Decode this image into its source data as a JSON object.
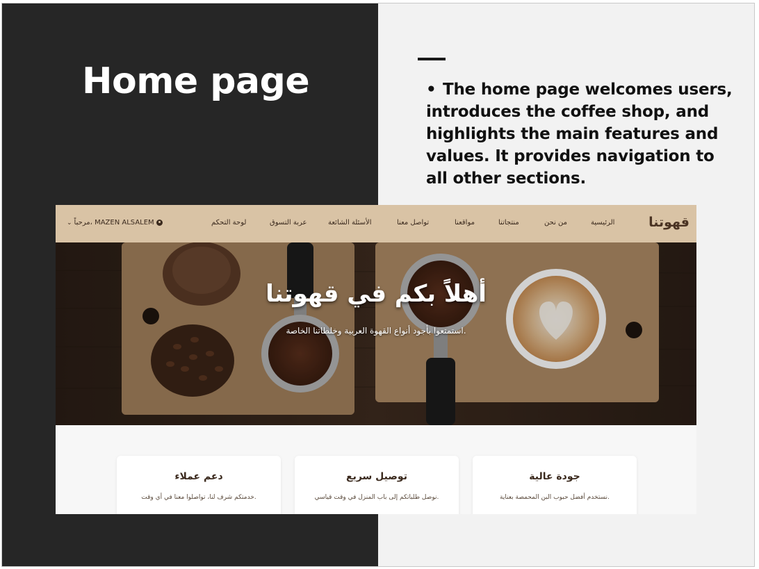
{
  "slide": {
    "title": "Home page",
    "bullet_marker": "•",
    "bullet_text": "The home page welcomes users, introduces the coffee shop, and highlights the main features and values. It provides navigation to all other sections."
  },
  "site": {
    "logo": "قهوتنا",
    "nav": {
      "home": "الرئيسية",
      "about": "من نحن",
      "products": "منتجاتنا",
      "locations": "مواقعنا",
      "contact": "تواصل معنا",
      "faq": "الأسئلة الشائعة",
      "cart": "عربة التسوق",
      "dashboard": "لوحة التحكم"
    },
    "user_greeting": "مرحباً، MAZEN ALSALEM",
    "hero": {
      "title": "أهلاً بكم في قهوتنا",
      "subtitle": "استمتعوا بأجود أنواع القهوة العربية وخلطاتنا الخاصة."
    },
    "features": [
      {
        "title": "جودة عالية",
        "text": "نستخدم أفضل حبوب البن المحمصة بعناية."
      },
      {
        "title": "توصيل سريع",
        "text": "نوصل طلباتكم إلى باب المنزل في وقت قياسي."
      },
      {
        "title": "دعم عملاء",
        "text": "خدمتكم شرف لنا، تواصلوا معنا في أي وقت."
      }
    ]
  },
  "colors": {
    "left_panel": "#262626",
    "right_panel": "#f2f2f2",
    "nav_background": "#d9c3a5",
    "brand_brown": "#4a3323"
  },
  "icons": [
    "user-icon",
    "chevron-down-icon"
  ]
}
